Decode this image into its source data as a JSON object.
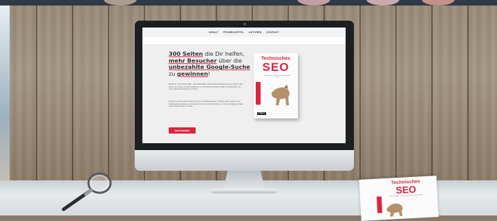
{
  "nav": [
    "INHALT",
    "PROBEKAPITEL",
    "AUTOREN",
    "KONTAKT"
  ],
  "headline": {
    "count": "300 Seiten",
    "t1": " die Dir helfen,",
    "more": "mehr Besucher",
    "t2": " über die",
    "google": "unbezahlte Google-Suche",
    "t3": "zu ",
    "win": "gewinnen",
    "t4": "!"
  },
  "paragraph1": "Erfahre in „Technisches SEO – Mit nachhaltiger Suchmaschinenoptimierung zum Erfolg\" alles was du tun musst, um Suchmaschinen von der Relevanz deiner Inhalte zu überzeugen, um mehr kostenlose Zugriffe zu erzielen!",
  "paragraph2": "Im Buch erwarten dich praxisnahe Tipps und Hilfestellungen. Verstehe unter anderem, wie Suchmaschinen arbeiten und erstelle Dir eine Arbeits-Prioritäten, um deine wichtigsten Inhalte auf die ersten Plätze zu heben.",
  "cta": "Jetzt bestellen",
  "book": {
    "title1": "Technisches",
    "title2": "SEO",
    "subtitle": "Mit nachhaltiger Suchmaschinenoptimierung zum Erfolg",
    "publisher": "O'REILLY"
  },
  "colors": {
    "accent": "#d8263d",
    "wood": "#9a8b78",
    "desk": "#e0e5e7"
  },
  "icons": [
    "magnifier-icon"
  ]
}
